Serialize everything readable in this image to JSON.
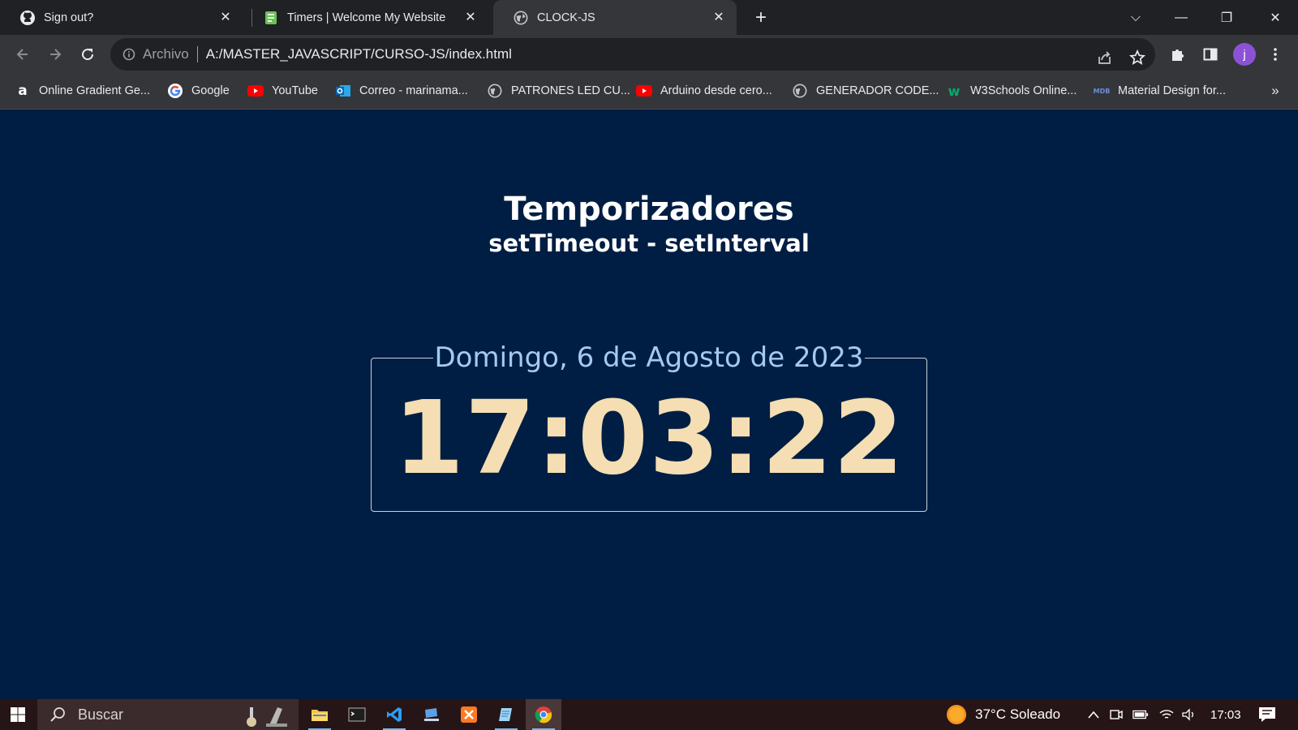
{
  "browser": {
    "tabs": [
      {
        "title": "Sign out?",
        "icon": "github-icon"
      },
      {
        "title": "Timers | Welcome My Website",
        "icon": "book-icon"
      },
      {
        "title": "CLOCK-JS",
        "icon": "globe-icon",
        "active": true
      }
    ],
    "new_tab": "+",
    "window_controls": {
      "tab_search": "⌵",
      "minimize": "—",
      "restore": "❐",
      "close": "✕"
    }
  },
  "toolbar": {
    "scheme_label": "Archivo",
    "url": "A:/MASTER_JAVASCRIPT/CURSO-JS/index.html",
    "profile_initial": "j"
  },
  "bookmarks": [
    {
      "label": "Online Gradient Ge...",
      "icon": "letter-a-icon"
    },
    {
      "label": "Google",
      "icon": "google-icon"
    },
    {
      "label": "YouTube",
      "icon": "youtube-icon"
    },
    {
      "label": "Correo - marinama...",
      "icon": "outlook-icon"
    },
    {
      "label": "PATRONES LED CU...",
      "icon": "globe-icon"
    },
    {
      "label": "Arduino desde cero...",
      "icon": "youtube-icon"
    },
    {
      "label": "GENERADOR CODE...",
      "icon": "globe-icon"
    },
    {
      "label": "W3Schools Online...",
      "icon": "w3schools-icon"
    },
    {
      "label": "Material Design for...",
      "icon": "mdb-icon"
    }
  ],
  "bookmarks_overflow": "»",
  "page": {
    "title": "Temporizadores",
    "subtitle": "setTimeout - setInterval",
    "date": "Domingo, 6 de Agosto de 2023",
    "time": "17:03:22"
  },
  "taskbar": {
    "search_placeholder": "Buscar",
    "weather": "37°C  Soleado",
    "clock": "17:03"
  },
  "colors": {
    "page_bg": "#001e43",
    "date_text": "#a4c9f2",
    "time_text": "#f5deb3",
    "browser_dark": "#202124",
    "browser_toolbar": "#35363a",
    "taskbar_bg": "#261516"
  }
}
